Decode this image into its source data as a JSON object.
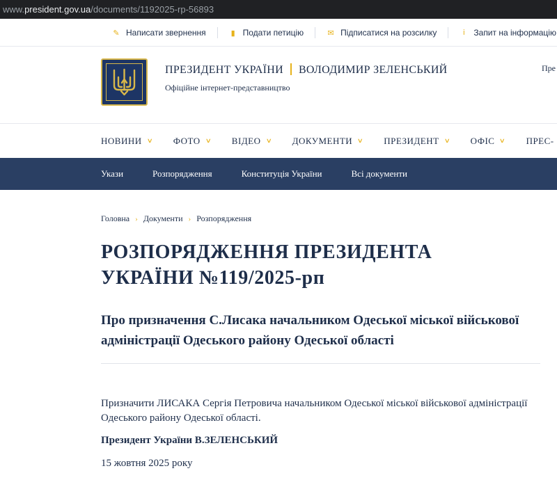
{
  "browser": {
    "url_prefix": "www.",
    "url_host": "president.gov.ua",
    "url_path": "/documents/1192025-rp-56893"
  },
  "topbar": {
    "links": [
      {
        "label": "Написати звернення",
        "icon": "pencil-icon"
      },
      {
        "label": "Подати петицію",
        "icon": "document-icon"
      },
      {
        "label": "Підписатися на розсилку",
        "icon": "envelope-icon"
      },
      {
        "label": "Запит на інформацію",
        "icon": "info-icon"
      }
    ]
  },
  "header": {
    "title_left": "ПРЕЗИДЕНТ УКРАЇНИ",
    "title_right": "ВОЛОДИМИР ЗЕЛЕНСЬКИЙ",
    "subtitle": "Офіційне інтернет-представництво",
    "lang_partial": "Пре"
  },
  "main_nav": {
    "items": [
      "НОВИНИ",
      "ФОТО",
      "ВІДЕО",
      "ДОКУМЕНТИ",
      "ПРЕЗИДЕНТ",
      "ОФІС",
      "ПРЕС-"
    ]
  },
  "sub_nav": {
    "items": [
      "Укази",
      "Розпорядження",
      "Конституція України",
      "Всі документи"
    ]
  },
  "breadcrumb": {
    "items": [
      "Головна",
      "Документи",
      "Розпорядження"
    ]
  },
  "document": {
    "title": "РОЗПОРЯДЖЕННЯ ПРЕЗИДЕНТА УКРАЇНИ №119/2025-рп",
    "subtitle": "Про призначення С.Лисака начальником Одеської міської військової адміністрації Одеського району Одеської області",
    "body": "Призначити ЛИСАКА Сергія Петровича начальником Одеської міської військової адміністрації Одеського району Одеської області.",
    "signature": "Президент України В.ЗЕЛЕНСЬКИЙ",
    "date": "15 жовтня 2025 року"
  },
  "colors": {
    "accent": "#e7b21a",
    "navy": "#2a3f63",
    "text": "#1e2e4a"
  }
}
